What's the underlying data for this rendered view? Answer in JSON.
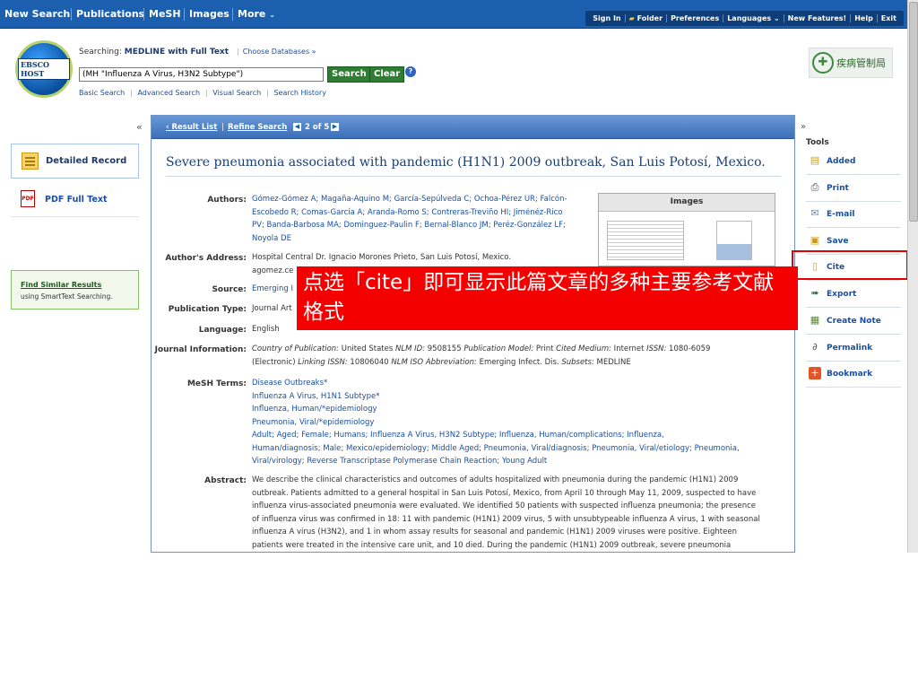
{
  "topnav": {
    "items": [
      "New Search",
      "Publications",
      "MeSH",
      "Images",
      "More"
    ],
    "right": [
      "Sign In",
      "Folder",
      "Preferences",
      "Languages",
      "New Features!",
      "Help",
      "Exit"
    ]
  },
  "header": {
    "logo_text": "EBSCO HOST",
    "searching_prefix": "Searching:",
    "searching_db": "MEDLINE with Full Text",
    "choose_db": "Choose Databases »",
    "query": "(MH \"Influenza A Virus, H3N2 Subtype\")",
    "search_btn": "Search",
    "clear_btn": "Clear",
    "sublinks": [
      "Basic Search",
      "Advanced Search",
      "Visual Search",
      "Search History"
    ],
    "cdc_text": "疾病管制局"
  },
  "left": {
    "detailed": "Detailed Record",
    "pdf": "PDF Full Text",
    "similar_title": "Find Similar Results",
    "similar_sub": "using SmartText Searching."
  },
  "record": {
    "result_list": "‹ Result List",
    "refine": "Refine Search",
    "position": "2 of 5",
    "title": "Severe pneumonia associated with pandemic (H1N1) 2009 outbreak, San Luis Potosí, Mexico.",
    "fields": {
      "authors_label": "Authors:",
      "authors": "Gómez-Gómez A; Magaña-Aquino M; García-Sepúlveda C; Ochoa-Pérez UR; Falcón-Escobedo R; Comas-García A; Aranda-Romo S; Contreras-Treviño HI; Jiménéz-Rico PV; Banda-Barbosa MA; Dominguez-Paulin F; Bernal-Blanco JM; Peréz-González LF; Noyola DE",
      "address_label": "Author's Address:",
      "address": "Hospital Central Dr. Ignacio Morones Prieto, San Luis Potosí, Mexico. agomez.ce",
      "source_label": "Source:",
      "source": "Emerging I",
      "pubtype_label": "Publication Type:",
      "pubtype": "Journal Art",
      "language_label": "Language:",
      "language": "English",
      "journal_label": "Journal Information:",
      "journal_line1_a": "Country of Publication:",
      "journal_line1_b": " United States ",
      "journal_line1_c": "NLM ID:",
      "journal_line1_d": " 9508155 ",
      "journal_line1_e": "Publication Model:",
      "journal_line1_f": " Print ",
      "journal_line1_g": "Cited Medium:",
      "journal_line1_h": " Internet ",
      "journal_line1_i": "ISSN:",
      "journal_line1_j": " 1080-6059",
      "journal_line2_a": "(Electronic) ",
      "journal_line2_b": "Linking ISSN:",
      "journal_line2_c": " 10806040 ",
      "journal_line2_d": "NLM ISO Abbreviation:",
      "journal_line2_e": " Emerging Infect. Dis. ",
      "journal_line2_f": "Subsets:",
      "journal_line2_g": " MEDLINE",
      "mesh_label": "MeSH Terms:",
      "mesh": [
        "Disease Outbreaks*",
        "Influenza A Virus, H1N1 Subtype*",
        "Influenza, Human/*epidemiology",
        "Pneumonia, Viral/*epidemiology",
        "Adult; Aged; Female; Humans; Influenza A Virus, H3N2 Subtype; Influenza, Human/complications; Influenza,",
        "Human/diagnosis; Male; Mexico/epidemiology; Middle Aged; Pneumonia, Viral/diagnosis; Pneumonia, Viral/etiology; Pneumonia,",
        "Viral/virology; Reverse Transcriptase Polymerase Chain Reaction; Young Adult"
      ],
      "abstract_label": "Abstract:",
      "abstract": [
        "We describe the clinical characteristics and outcomes of adults hospitalized with pneumonia during the pandemic (H1N1) 2009",
        "outbreak. Patients admitted to a general hospital in San Luis Potosí, Mexico, from April 10 through May 11, 2009, suspected to have",
        "influenza virus-associated pneumonia were evaluated. We identified 50 patients with suspected influenza pneumonia; the presence",
        "of influenza virus was confirmed in 18: 11 with pandemic (H1N1) 2009 virus, 5 with unsubtypeable influenza A virus, 1 with seasonal",
        "influenza A virus (H3N2), and 1 in whom assay results for seasonal and pandemic (H1N1) 2009 viruses were positive. Eighteen",
        "patients were treated in the intensive care unit, and 10 died. During the pandemic (H1N1) 2009 outbreak, severe pneumonia"
      ]
    },
    "images_title": "Images"
  },
  "tools": {
    "title": "Tools",
    "items": [
      "Added",
      "Print",
      "E-mail",
      "Save",
      "Cite",
      "Export",
      "Create Note",
      "Permalink",
      "Bookmark"
    ]
  },
  "annotation": "点选「cite」即可显示此篇文章的多种主要参考文献格式"
}
